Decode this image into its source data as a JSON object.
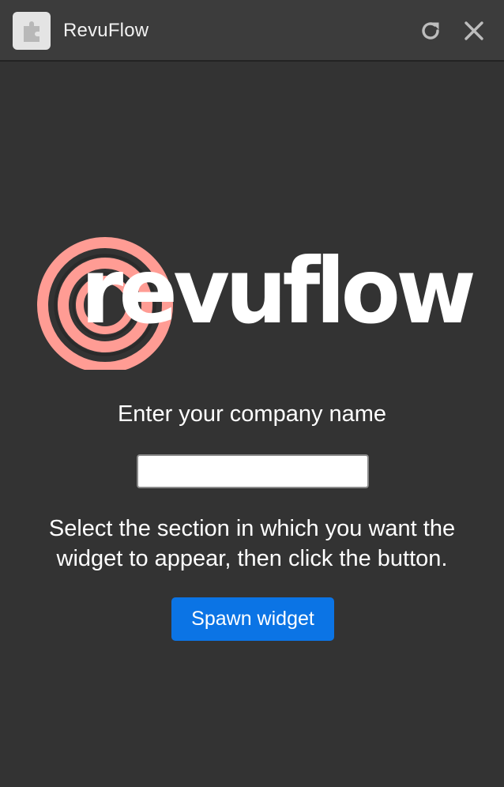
{
  "window": {
    "title": "RevuFlow",
    "icons": {
      "app": "puzzle-piece-icon",
      "reload": "reload-icon",
      "close": "close-icon"
    }
  },
  "logo": {
    "wordmark": "revuflow",
    "colors": {
      "rings": "#ff9c94",
      "text": "#ffffff"
    }
  },
  "form": {
    "company_label": "Enter your company name",
    "company_value": "",
    "company_placeholder": "",
    "instructions": "Select the section in which you want the widget to appear, then click the button.",
    "spawn_button": "Spawn widget"
  },
  "colors": {
    "background": "#333333",
    "titlebar": "#3c3c3c",
    "accent": "#0b74e5"
  }
}
